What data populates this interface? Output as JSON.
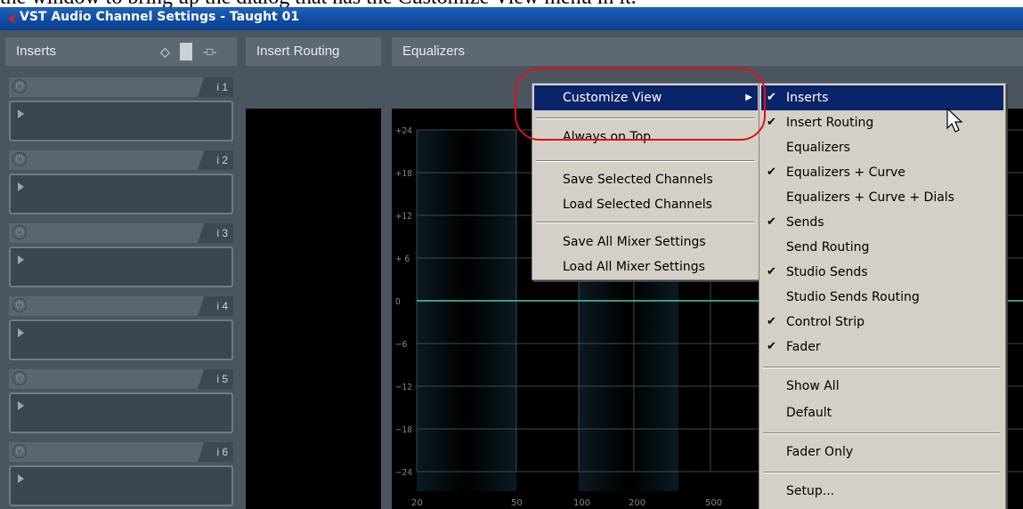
{
  "caption": "the window to bring up the dialog that has the Customize View menu in it.",
  "window": {
    "title": "VST Audio Channel Settings - Taught 01"
  },
  "panels": {
    "inserts": {
      "label": "Inserts",
      "diamond_icon": "◇",
      "toggle_icon": "-□-"
    },
    "insert_routing": {
      "label": "Insert Routing"
    },
    "equalizers": {
      "label": "Equalizers"
    }
  },
  "insert_slots": [
    {
      "label": "i 1"
    },
    {
      "label": "i 2"
    },
    {
      "label": "i 3"
    },
    {
      "label": "i 4"
    },
    {
      "label": "i 5"
    },
    {
      "label": "i 6"
    }
  ],
  "eq": {
    "y_labels": [
      "+24",
      "+18",
      "+12",
      "+ 6",
      "0",
      "−6",
      "−12",
      "−18",
      "−24"
    ],
    "x_labels": [
      "20",
      "50",
      "100",
      "200",
      "500"
    ]
  },
  "context_menu": {
    "customize_view": "Customize View",
    "always_on_top": "Always on Top",
    "save_selected": "Save Selected Channels",
    "load_selected": "Load Selected Channels",
    "save_all": "Save All Mixer Settings",
    "load_all": "Load All Mixer Settings"
  },
  "submenu": {
    "items": [
      {
        "label": "Inserts",
        "checked": true
      },
      {
        "label": "Insert Routing",
        "checked": true
      },
      {
        "label": "Equalizers",
        "checked": false
      },
      {
        "label": "Equalizers + Curve",
        "checked": true
      },
      {
        "label": "Equalizers + Curve + Dials",
        "checked": false
      },
      {
        "label": "Sends",
        "checked": true
      },
      {
        "label": "Send Routing",
        "checked": false
      },
      {
        "label": "Studio Sends",
        "checked": true
      },
      {
        "label": "Studio Sends Routing",
        "checked": false
      },
      {
        "label": "Control Strip",
        "checked": true
      },
      {
        "label": "Fader",
        "checked": true
      }
    ],
    "show_all": "Show All",
    "default": "Default",
    "fader_only": "Fader Only",
    "setup": "Setup..."
  },
  "colors": {
    "highlight": "#0a246a",
    "callout": "#e01010",
    "eq_line": "#4fc8a8"
  }
}
